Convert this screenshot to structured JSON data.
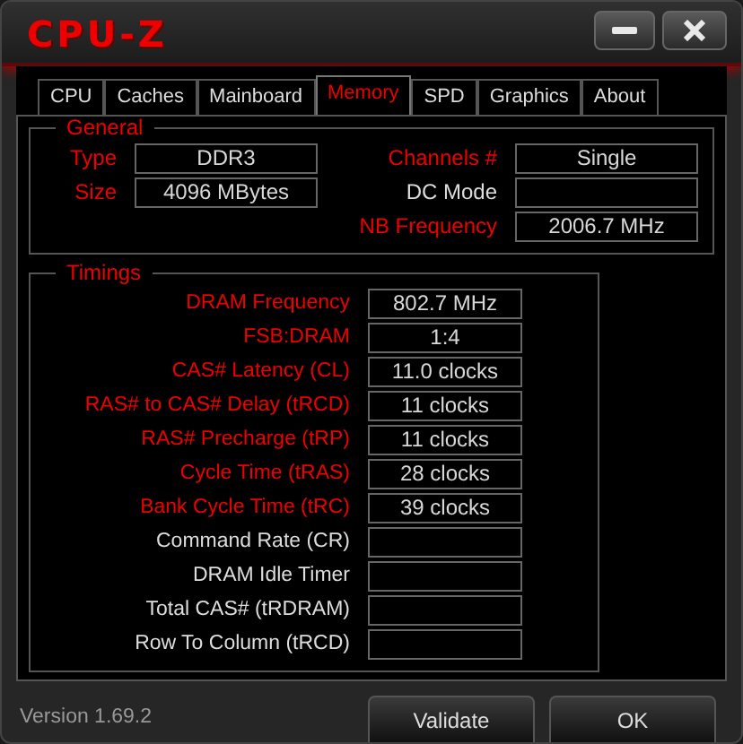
{
  "window": {
    "title": "CPU-Z"
  },
  "tabs": [
    {
      "label": "CPU",
      "selected": false
    },
    {
      "label": "Caches",
      "selected": false
    },
    {
      "label": "Mainboard",
      "selected": false
    },
    {
      "label": "Memory",
      "selected": true
    },
    {
      "label": "SPD",
      "selected": false
    },
    {
      "label": "Graphics",
      "selected": false
    },
    {
      "label": "About",
      "selected": false
    }
  ],
  "general": {
    "title": "General",
    "fields": [
      {
        "label": "Type",
        "value": "DDR3",
        "highlighted": true
      },
      {
        "label": "Channels #",
        "value": "Single",
        "highlighted": true
      },
      {
        "label": "Size",
        "value": "4096 MBytes",
        "highlighted": true
      },
      {
        "label": "DC Mode",
        "highlighted": false
      },
      {
        "label": "NB Frequency",
        "value": "2006.7 MHz",
        "highlighted": true
      }
    ]
  },
  "timings": {
    "title": "Timings",
    "fields": [
      {
        "label": "DRAM Frequency",
        "value": "802.7 MHz",
        "highlighted": true
      },
      {
        "label": "FSB:DRAM",
        "value": "1:4",
        "highlighted": true
      },
      {
        "label": "CAS# Latency (CL)",
        "value": "11.0 clocks",
        "highlighted": true
      },
      {
        "label": "RAS# to CAS# Delay (tRCD)",
        "value": "11 clocks",
        "highlighted": true
      },
      {
        "label": "RAS# Precharge (tRP)",
        "value": "11 clocks",
        "highlighted": true
      },
      {
        "label": "Cycle Time (tRAS)",
        "value": "28 clocks",
        "highlighted": true
      },
      {
        "label": "Bank Cycle Time (tRC)",
        "value": "39 clocks",
        "highlighted": true
      },
      {
        "label": "Command Rate (CR)",
        "highlighted": false
      },
      {
        "label": "DRAM Idle Timer",
        "highlighted": false
      },
      {
        "label": "Total CAS# (tRDRAM)",
        "highlighted": false
      },
      {
        "label": "Row To Column (tRCD)",
        "highlighted": false
      }
    ]
  },
  "status_bar": {
    "version": "Version 1.69.2"
  },
  "buttons": [
    "Validate",
    "OK"
  ]
}
